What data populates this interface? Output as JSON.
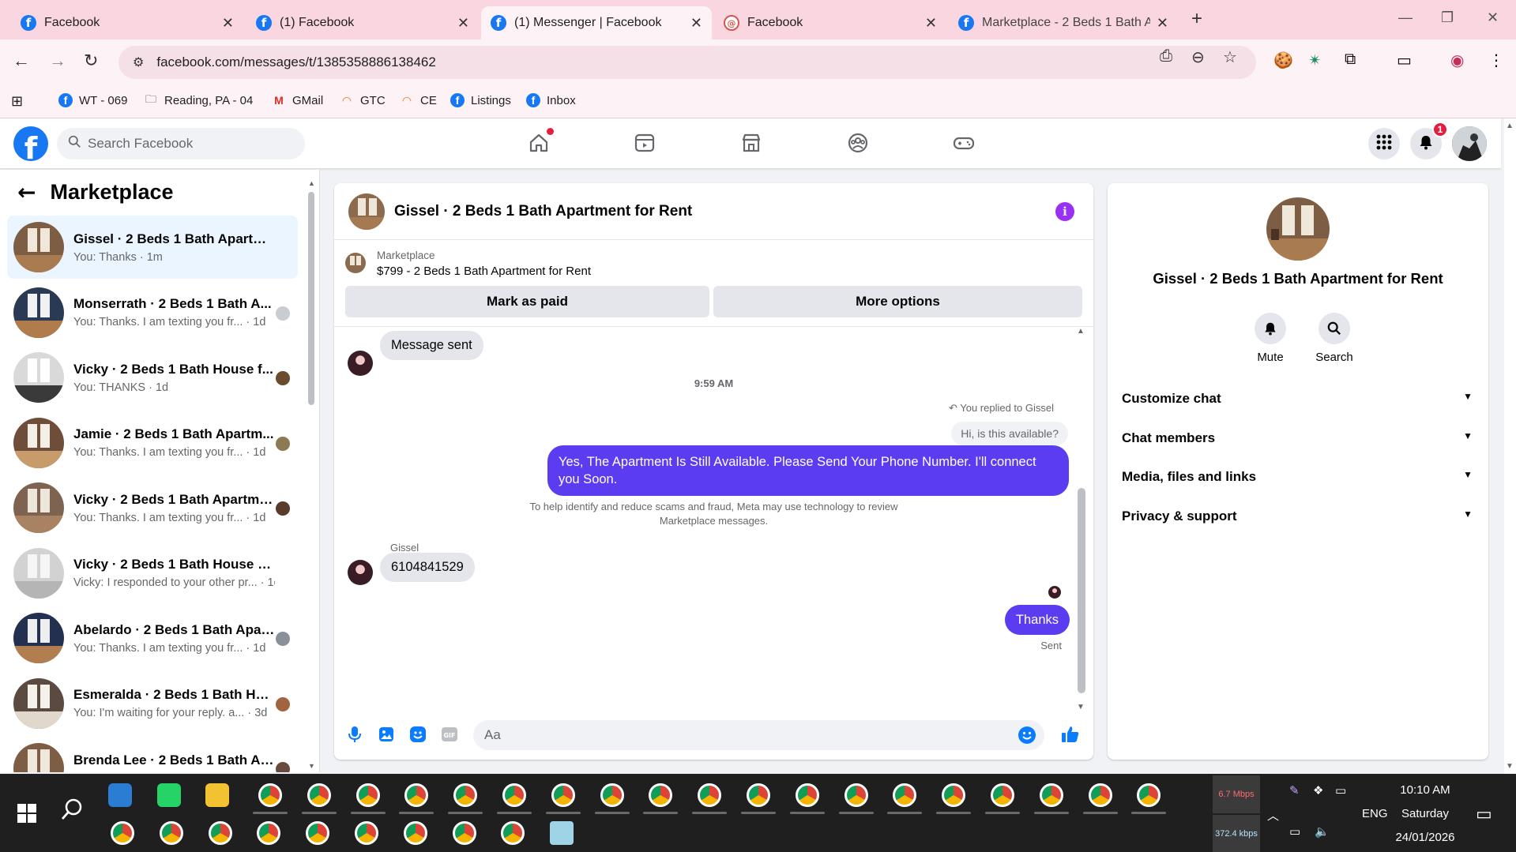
{
  "browser": {
    "tabs": [
      {
        "title": "Facebook",
        "active": false
      },
      {
        "title": "(1) Facebook",
        "active": false
      },
      {
        "title": "(1) Messenger | Facebook",
        "active": true
      },
      {
        "title": "Facebook",
        "active": false
      },
      {
        "title": "Marketplace - 2 Beds 1 Bath Ap",
        "active": false
      }
    ],
    "url": "facebook.com/messages/t/1385358886138462",
    "bookmarks": [
      {
        "label": "WT - 069",
        "icon": "facebook-icon"
      },
      {
        "label": "Reading, PA - 04",
        "icon": "folder-icon"
      },
      {
        "label": "GMail",
        "icon": "gmail-icon"
      },
      {
        "label": "GTC",
        "icon": "rainbow-icon"
      },
      {
        "label": "CE",
        "icon": "rainbow-icon"
      },
      {
        "label": "Listings",
        "icon": "facebook-icon"
      },
      {
        "label": "Inbox",
        "icon": "facebook-icon"
      }
    ]
  },
  "fb": {
    "search_placeholder": "Search Facebook",
    "notification_count": "1",
    "brand_color": "#1877f2"
  },
  "sidebar": {
    "title": "Marketplace",
    "conversations": [
      {
        "name": "Gissel · 2 Beds 1 Bath Apartmen...",
        "preview": "You: Thanks · 1m",
        "active": true
      },
      {
        "name": "Monserrath · 2 Beds 1 Bath A...",
        "preview": "You: Thanks. I am texting you fr... · 1d"
      },
      {
        "name": "Vicky · 2 Beds 1 Bath House f...",
        "preview": "You: THANKS · 1d"
      },
      {
        "name": "Jamie · 2 Beds 1 Bath Apartm...",
        "preview": "You: Thanks. I am texting you fr... · 1d"
      },
      {
        "name": "Vicky · 2 Beds 1 Bath Apartme...",
        "preview": "You: Thanks. I am texting you fr... · 1d"
      },
      {
        "name": "Vicky · 2 Beds 1 Bath House for ...",
        "preview": "Vicky: I responded to your other pr... · 1d"
      },
      {
        "name": "Abelardo · 2 Beds 1 Bath Apar...",
        "preview": "You: Thanks. I am texting you fr... · 1d"
      },
      {
        "name": "Esmeralda · 2 Beds 1 Bath Ho...",
        "preview": "You: I'm waiting for your reply. a... · 3d"
      },
      {
        "name": "Brenda Lee · 2 Beds 1 Bath Ap...",
        "preview": "You: I'm waiting for your reply. a... · 3d"
      }
    ]
  },
  "chat": {
    "title": "Gissel · 2 Beds 1 Bath Apartment for Rent",
    "marketplace_label": "Marketplace",
    "listing": "$799 - 2 Beds 1 Bath Apartment for Rent",
    "mark_paid": "Mark as paid",
    "more_options": "More options",
    "msg_sent": "Message sent",
    "timestamp": "9:59 AM",
    "replied_note": "You replied to Gissel",
    "quoted": "Hi, is this available?",
    "outgoing_1": "Yes, The Apartment Is Still Available. Please Send Your Phone Number. I'll connect you Soon.",
    "safety_note_1": "To help identify and reduce scams and fraud, Meta may use technology to review",
    "safety_note_2": "Marketplace messages.",
    "sender_name": "Gissel",
    "incoming_phone": "6104841529",
    "outgoing_2": "Thanks",
    "status": "Sent",
    "input_placeholder": "Aa",
    "accent_color": "#5b3cf0"
  },
  "info": {
    "title": "Gissel · 2 Beds 1 Bath Apartment for Rent",
    "mute": "Mute",
    "search": "Search",
    "sections": [
      "Customize chat",
      "Chat members",
      "Media, files and links",
      "Privacy & support"
    ]
  },
  "taskbar": {
    "net_down": "6.7 Mbps",
    "net_up": "372.4 kbps",
    "lang": "ENG",
    "time": "10:10 AM",
    "day": "Saturday",
    "date": "24/01/2026"
  }
}
